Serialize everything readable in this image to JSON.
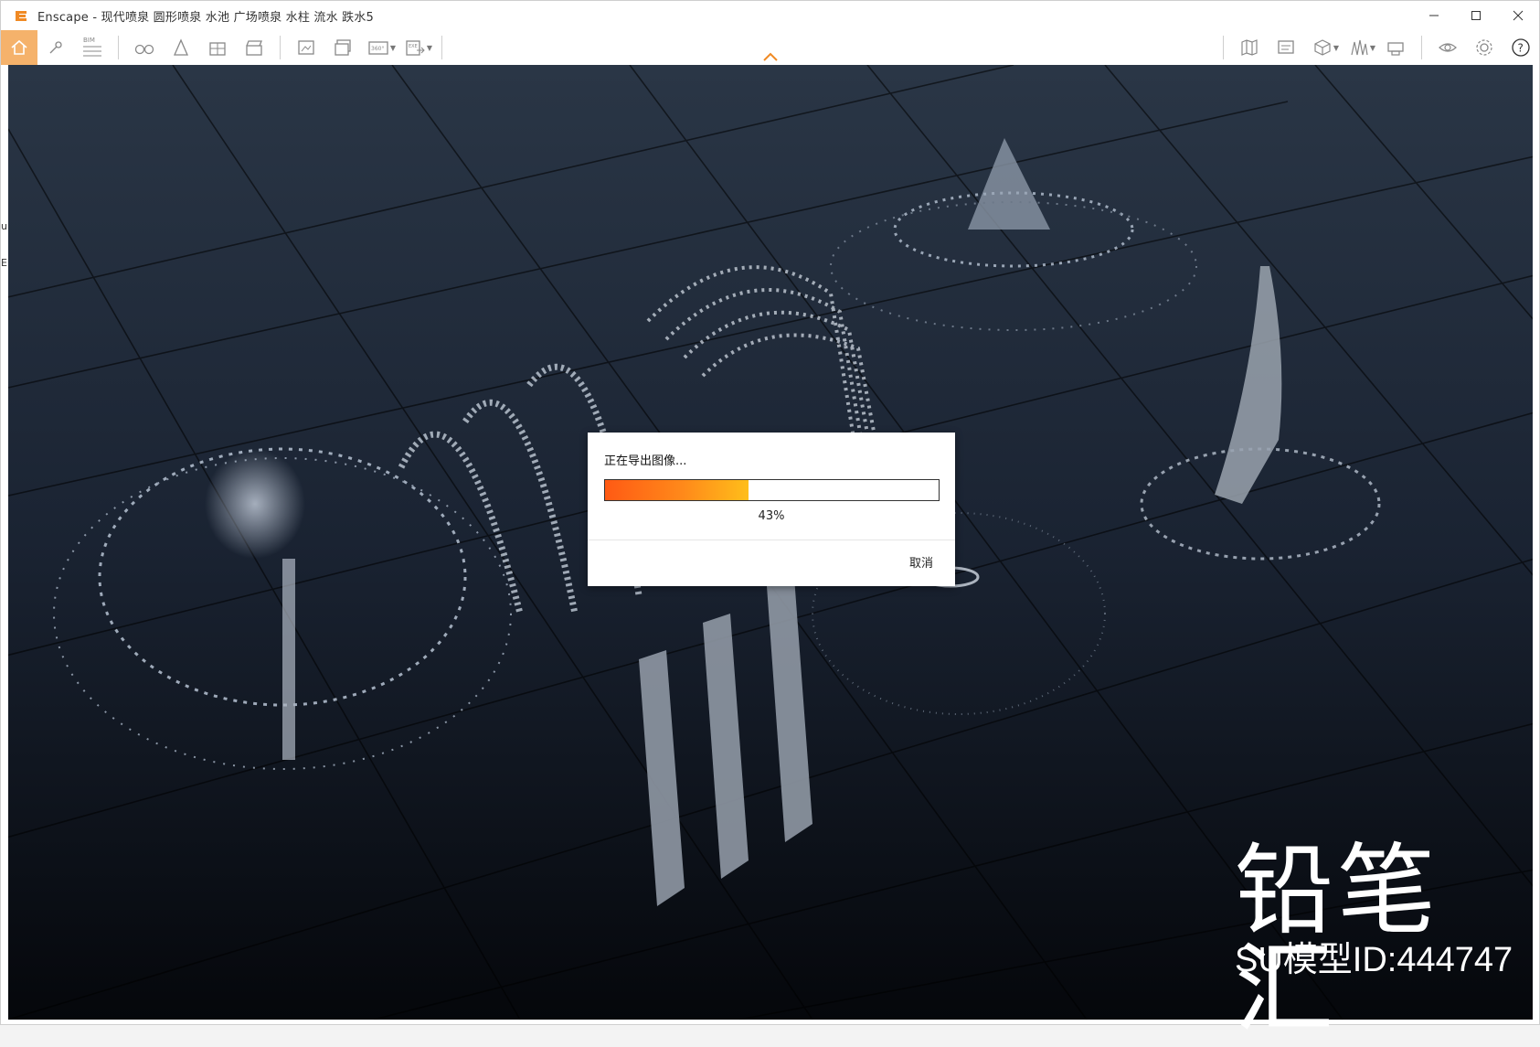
{
  "window": {
    "title": "Enscape - 现代喷泉 圆形喷泉 水池 广场喷泉 水柱 流水 跌水5",
    "brand_color": "#f08a24"
  },
  "toolbar": {
    "items": [
      {
        "icon": "home-icon",
        "active": true
      },
      {
        "icon": "walk-mode-icon"
      },
      {
        "icon": "bim-icon",
        "label": "BIM"
      },
      {
        "icon": "binoculars-icon"
      },
      {
        "icon": "asset-library-icon"
      },
      {
        "icon": "material-editor-icon"
      },
      {
        "icon": "video-editor-icon"
      },
      {
        "icon": "screenshot-icon"
      },
      {
        "icon": "batch-render-icon"
      },
      {
        "icon": "panorama-icon",
        "label": "360°"
      },
      {
        "icon": "export-icon",
        "label": "EXE"
      },
      {
        "icon": "map-icon"
      },
      {
        "icon": "collaborative-annotation-icon"
      },
      {
        "icon": "cube-view-icon"
      },
      {
        "icon": "atmosphere-icon"
      },
      {
        "icon": "capture-icon"
      },
      {
        "icon": "visibility-icon"
      },
      {
        "icon": "settings-icon"
      },
      {
        "icon": "help-icon",
        "label": "?"
      }
    ]
  },
  "left_strip": {
    "chars": [
      "u",
      "E"
    ]
  },
  "dialog": {
    "title": "正在导出图像...",
    "progress_percent": 43,
    "progress_label": "43%",
    "cancel_label": "取消"
  },
  "overlay": {
    "watermark_text": "铅笔汇",
    "model_id": "SU模型ID:444747"
  }
}
